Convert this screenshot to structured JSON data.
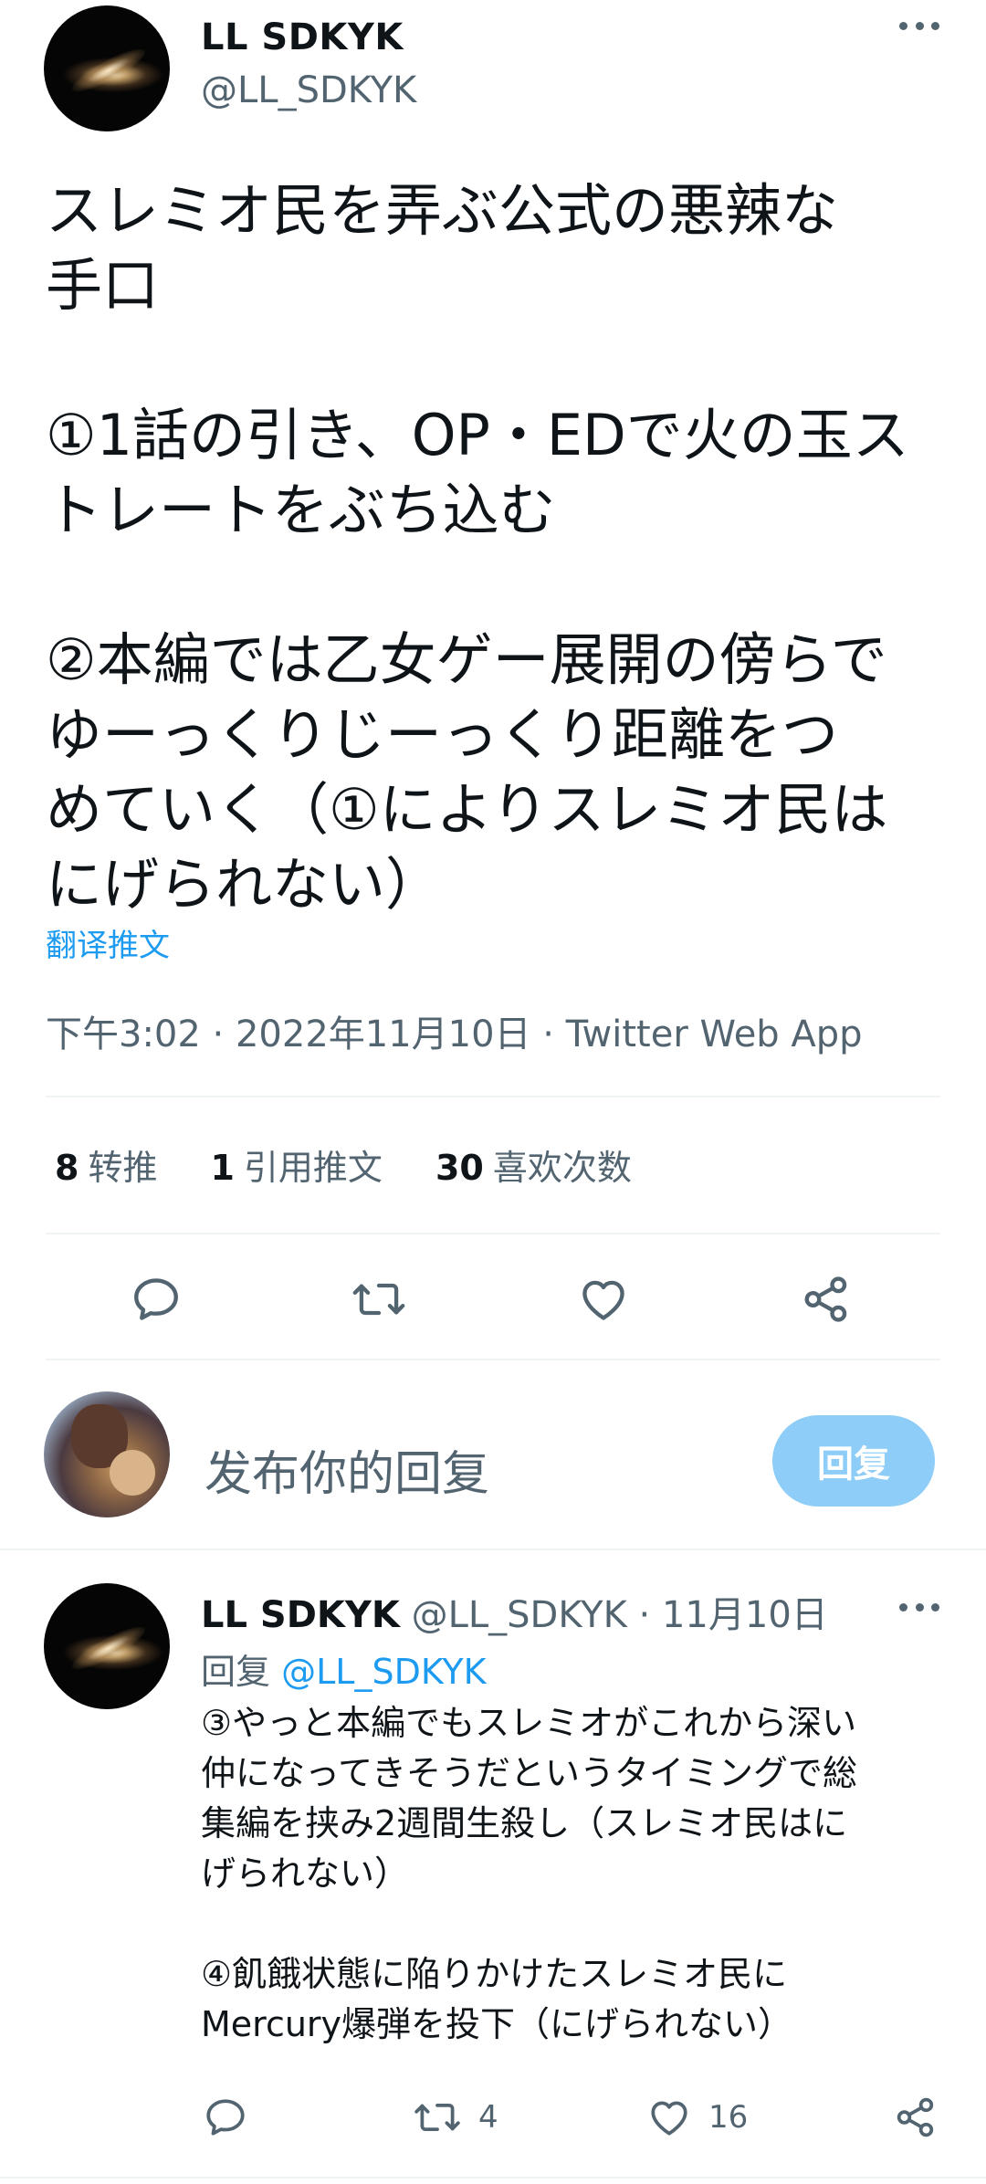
{
  "tweet": {
    "author_name": "LL SDKYK",
    "author_handle": "@LL_SDKYK",
    "text": "スレミオ民を弄ぶ公式の悪辣な\n手口\n\n①1話の引き、OP・EDで火の玉ス\nトレートをぶち込む\n\n②本編では乙女ゲー展開の傍らで\nゆーっくりじーっくり距離をつ\nめていく（①によりスレミオ民は\nにげられない）",
    "translate_label": "翻译推文",
    "timestamp": "下午3:02 · 2022年11月10日 · Twitter Web App",
    "stats": {
      "retweets_count": "8",
      "retweets_label": "转推",
      "quotes_count": "1",
      "quotes_label": "引用推文",
      "likes_count": "30",
      "likes_label": "喜欢次数"
    },
    "actions": [
      "reply-icon",
      "retweet-icon",
      "like-icon",
      "share-icon"
    ]
  },
  "composer": {
    "placeholder": "发布你的回复",
    "button_label": "回复"
  },
  "reply_tweet": {
    "author_name": "LL SDKYK",
    "author_handle": "@LL_SDKYK",
    "separator": "·",
    "date": "11月10日",
    "reply_to_prefix": "回复",
    "reply_to_mention": "@LL_SDKYK",
    "text": "③やっと本編でもスレミオがこれから深い\n仲になってきそうだというタイミングで総\n集編を挟み2週間生殺し（スレミオ民はに\nげられない）\n\n④飢餓状態に陥りかけたスレミオ民に\nMercury爆弾を投下（にげられない）",
    "retweet_count": "4",
    "like_count": "16"
  },
  "colors": {
    "text_primary": "#0f1419",
    "text_secondary": "#536471",
    "accent": "#1d9bf0",
    "button_disabled": "#8ecdf7",
    "divider": "#eff3f4"
  }
}
